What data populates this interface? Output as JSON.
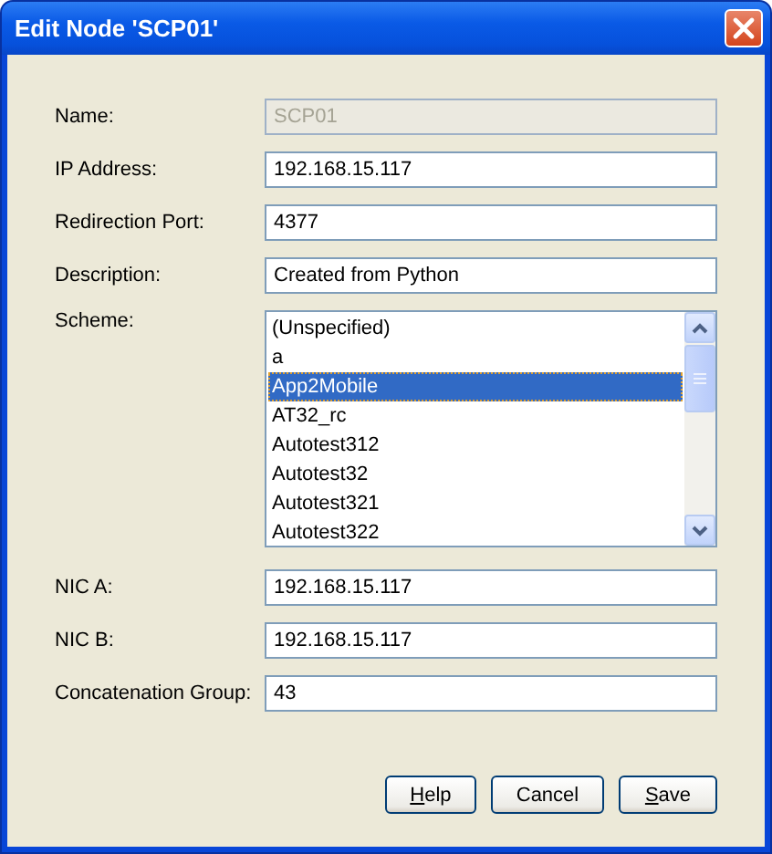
{
  "window": {
    "title": "Edit Node 'SCP01'"
  },
  "fields": [
    {
      "kind": "text",
      "label": "Name:",
      "value": "SCP01",
      "disabled": true
    },
    {
      "kind": "text",
      "label": "IP Address:",
      "value": "192.168.15.117",
      "disabled": false
    },
    {
      "kind": "text",
      "label": "Redirection Port:",
      "value": "4377",
      "disabled": false
    },
    {
      "kind": "text",
      "label": "Description:",
      "value": "Created from Python",
      "disabled": false
    },
    {
      "kind": "list",
      "label": "Scheme:",
      "items": [
        {
          "label": "(Unspecified)",
          "selected": false
        },
        {
          "label": "a",
          "selected": false
        },
        {
          "label": "App2Mobile",
          "selected": true
        },
        {
          "label": "AT32_rc",
          "selected": false
        },
        {
          "label": "Autotest312",
          "selected": false
        },
        {
          "label": "Autotest32",
          "selected": false
        },
        {
          "label": "Autotest321",
          "selected": false
        },
        {
          "label": "Autotest322",
          "selected": false
        }
      ]
    },
    {
      "kind": "text",
      "label": "NIC A:",
      "value": "192.168.15.117",
      "disabled": false
    },
    {
      "kind": "text",
      "label": "NIC B:",
      "value": "192.168.15.117",
      "disabled": false
    },
    {
      "kind": "text",
      "label": "Concatenation Group:",
      "value": "43",
      "disabled": false
    }
  ],
  "buttons": [
    {
      "label": "Help",
      "mnemonic": true
    },
    {
      "label": "Cancel",
      "mnemonic": false
    },
    {
      "label": "Save",
      "mnemonic": true
    }
  ]
}
